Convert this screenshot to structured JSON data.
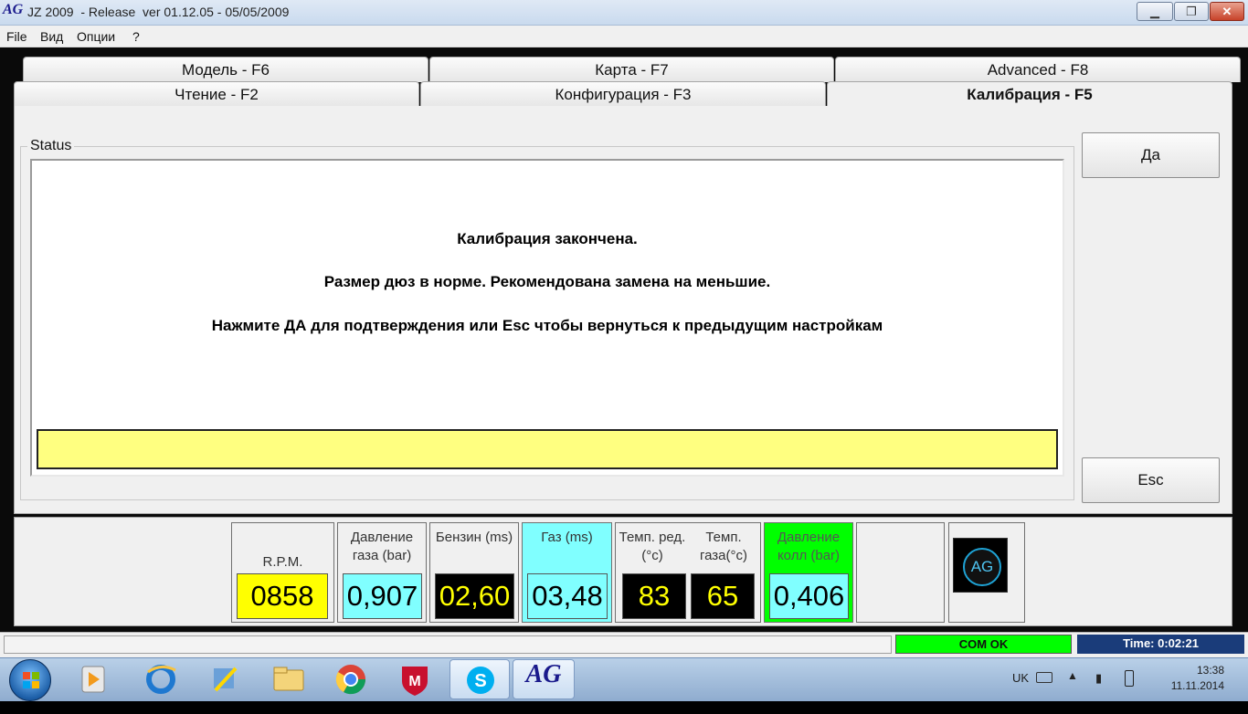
{
  "window": {
    "logo": "AG",
    "title": "JZ 2009  - Release  ver 01.12.05 - 05/05/2009",
    "min": "▁",
    "max": "❐",
    "close": "✕"
  },
  "menu": [
    "File",
    "Вид",
    "Опции",
    "?"
  ],
  "tabs_back": [
    "Модель - F6",
    "Карта - F7",
    "Advanced - F8"
  ],
  "tabs_front": [
    "Чтение - F2",
    "Конфигурация - F3",
    "Калибрация - F5"
  ],
  "status": {
    "legend": "Status",
    "messages": [
      "Калибрация закончена.",
      "Размер дюз в норме. Рекомендована замена на меньшие.",
      "Нажмите ДА для подтверждения или Esc чтобы вернуться к предыдущим настройкам"
    ]
  },
  "buttons": {
    "yes": "Да",
    "esc": "Esc"
  },
  "gauges": {
    "rpm": {
      "label": "R.P.M.",
      "value": "0858"
    },
    "gas_pressure": {
      "label": "Давление газа (bar)",
      "value": "0,907"
    },
    "petrol": {
      "label": "Бензин (ms)",
      "value": "02,60"
    },
    "gas": {
      "label": "Газ (ms)",
      "value": "03,48"
    },
    "temp_reducer": {
      "label": "Темп. ред.(°c)",
      "value": "83"
    },
    "temp_gas": {
      "label": "Темп. газа(°c)",
      "value": "65"
    },
    "manifold_pressure": {
      "label": "Давление колл (bar)",
      "value": "0,406"
    },
    "logo": "AG"
  },
  "statusbar": {
    "com": "COM OK",
    "time": "Time: 0:02:21"
  },
  "taskbar": {
    "lang": "UK",
    "clock": "13:38",
    "date": "11.11.2014",
    "active_app": "AG"
  },
  "colors": {
    "yellow": "#ffff00",
    "cyan": "#80ffff",
    "green": "#00ff00",
    "status_field": "#ffff80"
  }
}
